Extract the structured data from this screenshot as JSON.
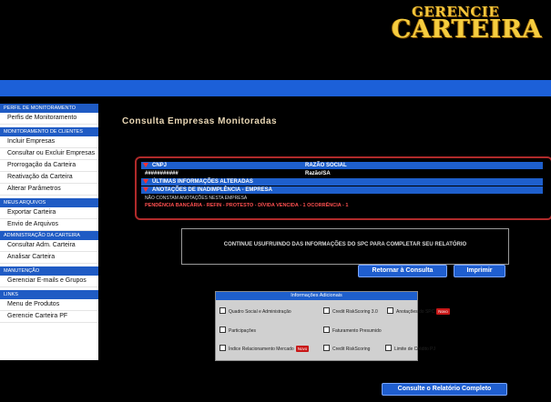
{
  "logo": {
    "line1": "GERENCIE",
    "line2": "CARTEIRA"
  },
  "sidebar": {
    "sections": [
      {
        "title": "PERFIL DE MONITORAMENTO",
        "items": [
          "Perfis de Monitoramento"
        ]
      },
      {
        "title": "MONITORAMENTO DE CLIENTES",
        "items": [
          "Incluir Empresas",
          "Consultar ou Excluir Empresas",
          "Prorrogação da Carteira",
          "Reativação da Carteira",
          "Alterar Parâmetros"
        ]
      },
      {
        "title": "MEUS ARQUIVOS",
        "items": [
          "Exportar Carteira",
          "Envio de Arquivos"
        ]
      },
      {
        "title": "ADMINISTRAÇÃO DA CARTEIRA",
        "items": [
          "Consultar Adm. Carteira",
          "Analisar Carteira"
        ]
      },
      {
        "title": "MANUTENÇÃO",
        "items": [
          "Gerenciar E-mails e Grupos"
        ]
      },
      {
        "title": "LINKS",
        "items": [
          "Menu de Produtos",
          "Gerencie Carteira PF"
        ]
      }
    ]
  },
  "main": {
    "title": "Consulta Empresas Monitoradas",
    "table": {
      "header_cnpj": "CNPJ",
      "header_razao": "RAZÃO SOCIAL",
      "cnpj_value": "###########",
      "razao_value": "Razão/SA",
      "row_ultimas": "ÚLTIMAS INFORMAÇÕES ALTERADAS",
      "row_anotacoes": "ANOTAÇÕES DE INADIMPLÊNCIA - EMPRESA",
      "note_line": "NÃO CONSTAM ANOTAÇÕES NESTA EMPRESA",
      "pendencias_line": "PENDÊNCIA BANCÁRIA - REFIN - PROTESTO - DÍVIDA VENCIDA - 1 OCORRÊNCIA - 1"
    },
    "message": "CONTINUE USUFRUINDO DAS INFORMAÇÕES DO SPC PARA COMPLETAR SEU RELATÓRIO",
    "buttons": {
      "return": "Retornar à Consulta",
      "print": "Imprimir",
      "complete": "Consulte o Relatório Completo"
    },
    "info": {
      "header": "Informações Adicionais",
      "options": {
        "quadro": "Quadro Social e Administração",
        "credit30": "Credit RiskScoring 3.0",
        "anotacoes_spc": "Anotações do SPC",
        "participacoes": "Participações",
        "faturamento": "Faturamento Presumido",
        "indice": "Índice Relacionamento Mercado",
        "credit": "Credit RiskScoring",
        "limite": "Limite de Crédito PJ"
      },
      "badge_new": "Novo"
    }
  },
  "colors": {
    "topbar": "#1c60d8",
    "sidebar_section": "#1f5bc4",
    "title": "#e8d6b4",
    "frame": "#b02a2a",
    "badge": "#c81818"
  }
}
